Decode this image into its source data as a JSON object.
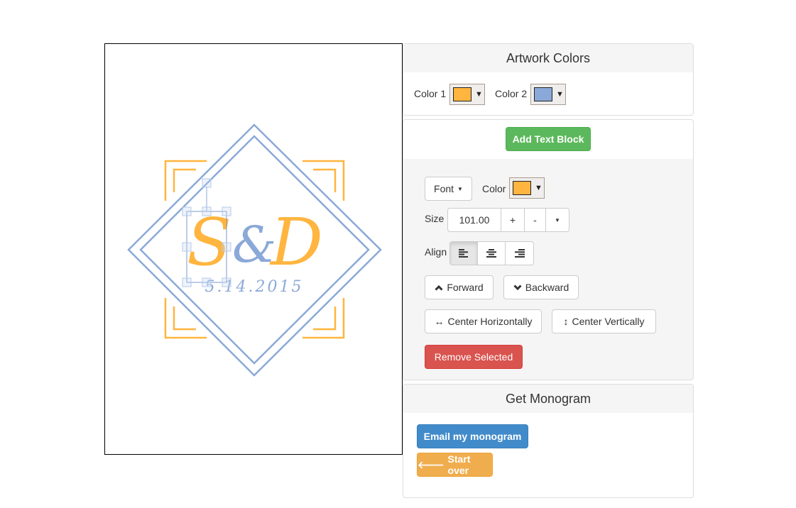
{
  "canvas": {
    "monogram_left": "S",
    "monogram_amp": "&",
    "monogram_right": "D",
    "date": "5.14.2015",
    "color1": "#FFB53F",
    "color2": "#8BA9D8"
  },
  "artwork_colors": {
    "title": "Artwork Colors",
    "color1_label": "Color 1",
    "color2_label": "Color 2",
    "color1": "#FFB53F",
    "color2": "#8BA9D8"
  },
  "text_block": {
    "add_label": "Add Text Block",
    "font_label": "Font",
    "color_label": "Color",
    "color": "#FFB53F",
    "size_label": "Size",
    "size_value": "101.00",
    "plus": "+",
    "minus": "-",
    "align_label": "Align",
    "align_selected": "left",
    "forward": "Forward",
    "backward": "Backward",
    "center_h": "Center Horizontally",
    "center_v": "Center Vertically",
    "remove": "Remove Selected"
  },
  "get_monogram": {
    "title": "Get Monogram",
    "email": "Email my monogram",
    "start_over": "Start over"
  }
}
